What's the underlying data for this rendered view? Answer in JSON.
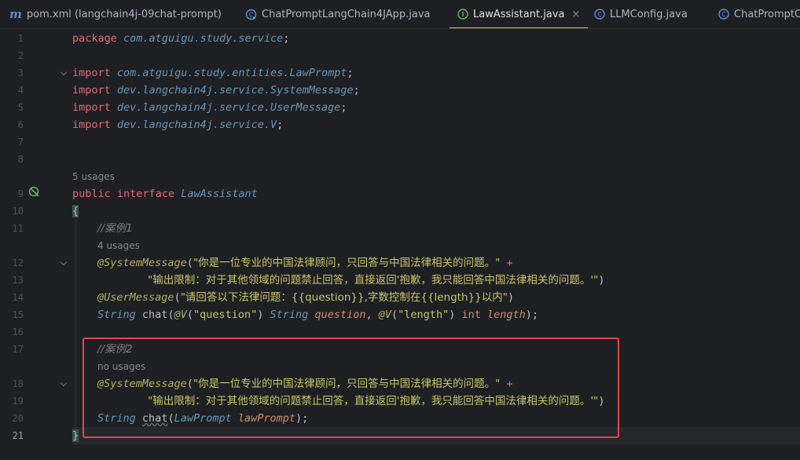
{
  "tabs": [
    {
      "label": "pom.xml (langchain4j-09chat-prompt)",
      "icon": "maven-m-icon",
      "active": false
    },
    {
      "label": "ChatPromptLangChain4JApp.java",
      "icon": "class-run-icon",
      "active": false
    },
    {
      "label": "LawAssistant.java",
      "icon": "interface-icon",
      "active": true,
      "close": "×"
    },
    {
      "label": "LLMConfig.java",
      "icon": "class-icon",
      "active": false
    },
    {
      "label": "ChatPromptC",
      "icon": "class-icon",
      "active": false
    }
  ],
  "editor": {
    "current_line": 21,
    "line_numbers": [
      "1",
      "2",
      "3",
      "4",
      "5",
      "6",
      "7",
      "8",
      "9",
      "10",
      "11",
      "12",
      "13",
      "14",
      "15",
      "16",
      "17",
      "18",
      "19",
      "20",
      "21"
    ],
    "hints": {
      "usages_5": "5 usages",
      "usages_4": "4 usages",
      "no_usages": "no usages"
    },
    "code": {
      "l1_kw": "package",
      "l1_pkg": "com.atguigu.study.service",
      "l3_kw": "import",
      "l3_pkg": "com.atguigu.study.entities.LawPrompt",
      "l4_kw": "import",
      "l4_pkg": "dev.langchain4j.service.SystemMessage",
      "l5_kw": "import",
      "l5_pkg": "dev.langchain4j.service.UserMessage",
      "l6_kw": "import",
      "l6_pkg": "dev.langchain4j.service.V",
      "l9_public": "public",
      "l9_interface": "interface",
      "l9_name": "LawAssistant",
      "l10_brace": "{",
      "l11_comment": "//案例1",
      "l12_ann": "@SystemMessage",
      "l12_str": "\"你是一位专业的中国法律顾问，只回答与中国法律相关的问题。\"",
      "l12_plus": "+",
      "l13_str": "\"输出限制：对于其他领域的问题禁止回答，直接返回'抱歉，我只能回答中国法律相关的问题。'\"",
      "l14_ann": "@UserMessage",
      "l14_str": "\"请回答以下法律问题：{{question}},字数控制在{{length}}以内\"",
      "l15_type": "String",
      "l15_method": "chat",
      "l15_ann1": "@V",
      "l15_str1": "\"question\"",
      "l15_type2": "String",
      "l15_param1": "question",
      "l15_ann2": "@V",
      "l15_str2": "\"length\"",
      "l15_int": "int",
      "l15_param2": "length",
      "l17_comment": "//案例2",
      "l18_ann": "@SystemMessage",
      "l18_str": "\"你是一位专业的中国法律顾问，只回答与中国法律相关的问题。\"",
      "l18_plus": "+",
      "l19_str": "\"输出限制：对于其他领域的问题禁止回答，直接返回'抱歉，我只能回答中国法律相关的问题。'\"",
      "l20_type": "String",
      "l20_method": "chat",
      "l20_ptype": "LawPrompt",
      "l20_param": "lawPrompt",
      "l21_brace": "}"
    }
  },
  "colors": {
    "background": "#1e1f22",
    "highlight_border": "#e0464f",
    "active_tab_underline": "#e8c46a"
  }
}
